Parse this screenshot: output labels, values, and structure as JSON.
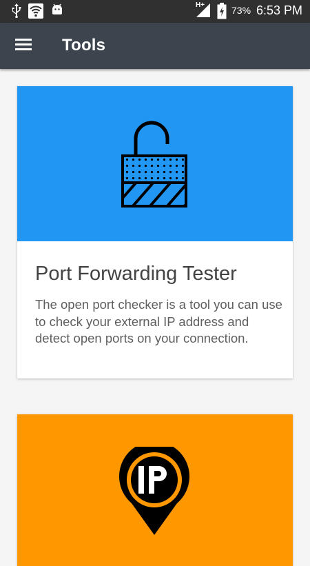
{
  "status_bar": {
    "icons": [
      "usb-icon",
      "wifi-icon",
      "android-icon",
      "signal-icon",
      "battery-icon"
    ],
    "network_type": "H+",
    "battery": "73%",
    "time": "6:53 PM"
  },
  "app_bar": {
    "menu_icon": "hamburger-menu-icon",
    "title": "Tools",
    "background": "#3d444d"
  },
  "cards": [
    {
      "icon": "open-padlock-icon",
      "color": "#2196f3",
      "title": "Port Forwarding Tester",
      "description": "The open port checker is a tool you can use to check your external IP address and detect open ports on your connection."
    },
    {
      "icon": "ip-location-pin-icon",
      "color": "#ff9800",
      "title": "",
      "description": ""
    }
  ]
}
